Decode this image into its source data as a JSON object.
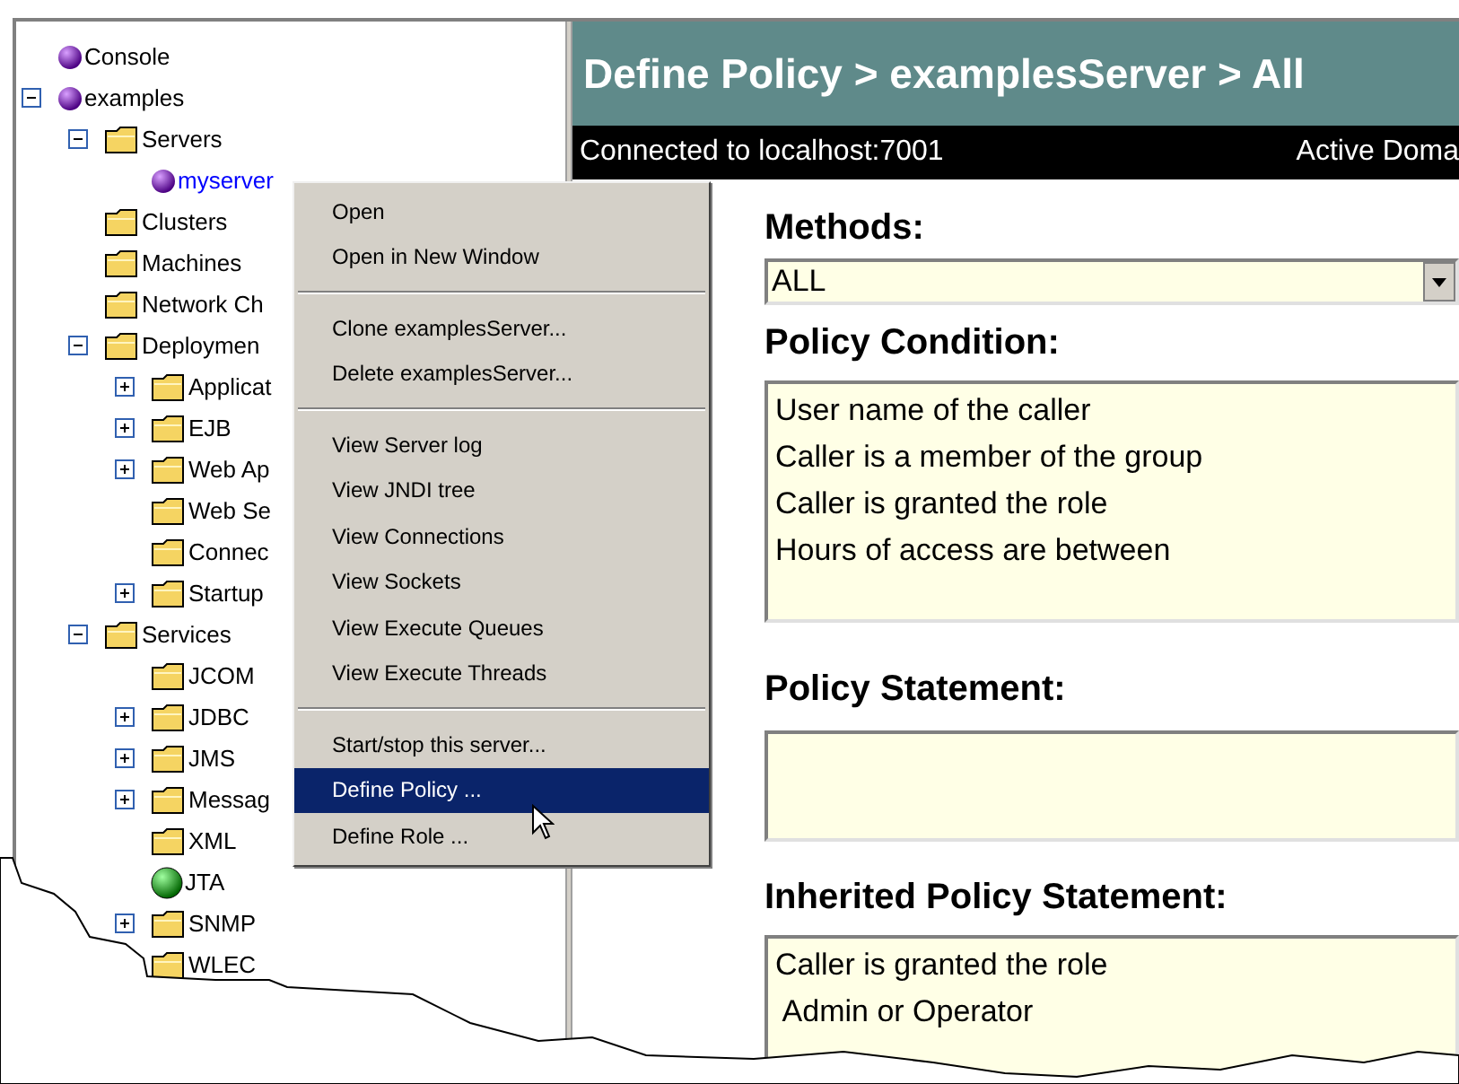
{
  "tree": [
    {
      "label": "Console",
      "kind": "server",
      "selected": false
    },
    {
      "label": "examples",
      "kind": "server",
      "selected": false,
      "expanded": true,
      "children": [
        {
          "label": "Servers",
          "kind": "folder",
          "selected": false,
          "expanded": true,
          "children": [
            {
              "label": "myserver",
              "kind": "server",
              "selected": true
            }
          ]
        },
        {
          "label": "Clusters",
          "kind": "folder",
          "selected": false
        },
        {
          "label": "Machines",
          "kind": "folder",
          "selected": false
        },
        {
          "label": "Network Ch",
          "kind": "folder",
          "selected": false
        },
        {
          "label": "Deploymen",
          "kind": "folder",
          "selected": false,
          "expanded": true,
          "children": [
            {
              "label": "Applicat",
              "kind": "folder",
              "selected": false,
              "expanded": false
            },
            {
              "label": "EJB",
              "kind": "folder",
              "selected": false,
              "expanded": false
            },
            {
              "label": "Web Ap",
              "kind": "folder",
              "selected": false,
              "expanded": false
            },
            {
              "label": "Web Se",
              "kind": "folder",
              "selected": false
            },
            {
              "label": "Connec",
              "kind": "folder",
              "selected": false
            },
            {
              "label": "Startup",
              "kind": "folder",
              "selected": false,
              "expanded": false
            }
          ]
        },
        {
          "label": "Services",
          "kind": "folder",
          "selected": false,
          "expanded": true,
          "children": [
            {
              "label": "JCOM",
              "kind": "folder",
              "selected": false
            },
            {
              "label": "JDBC",
              "kind": "folder",
              "selected": false,
              "expanded": false
            },
            {
              "label": "JMS",
              "kind": "folder",
              "selected": false,
              "expanded": false
            },
            {
              "label": "Messag",
              "kind": "folder",
              "selected": false,
              "expanded": false
            },
            {
              "label": "XML",
              "kind": "folder",
              "selected": false
            },
            {
              "label": "JTA",
              "kind": "running",
              "selected": false
            },
            {
              "label": "SNMP",
              "kind": "folder",
              "selected": false,
              "expanded": false
            },
            {
              "label": "WLEC",
              "kind": "folder",
              "selected": false
            }
          ]
        }
      ]
    }
  ],
  "context_menu": [
    {
      "kind": "item",
      "label": "Open",
      "selected": false
    },
    {
      "kind": "item",
      "label": "Open in New Window",
      "selected": false
    },
    {
      "kind": "separator"
    },
    {
      "kind": "item",
      "label": "Clone examplesServer...",
      "selected": false
    },
    {
      "kind": "item",
      "label": "Delete examplesServer...",
      "selected": false
    },
    {
      "kind": "separator"
    },
    {
      "kind": "item",
      "label": "View Server log",
      "selected": false
    },
    {
      "kind": "item",
      "label": "View JNDI tree",
      "selected": false
    },
    {
      "kind": "item",
      "label": "View Connections",
      "selected": false
    },
    {
      "kind": "item",
      "label": "View Sockets",
      "selected": false
    },
    {
      "kind": "item",
      "label": "View Execute Queues",
      "selected": false
    },
    {
      "kind": "item",
      "label": "View Execute Threads",
      "selected": false
    },
    {
      "kind": "separator"
    },
    {
      "kind": "item",
      "label": "Start/stop this server...",
      "selected": false
    },
    {
      "kind": "item",
      "label": "Define Policy ...",
      "selected": true
    },
    {
      "kind": "item",
      "label": "Define Role ...",
      "selected": false
    }
  ],
  "page": {
    "title": "Define Policy > examplesServer > All",
    "connection": "Connected to localhost:7001",
    "domain": "Active Doma",
    "methods_label": "Methods:",
    "methods_value": "ALL",
    "condition_label": "Policy Condition:",
    "conditions": [
      "User name of the caller",
      "Caller is a member of the group",
      "Caller is granted the role",
      "Hours of access are between"
    ],
    "statement_label": "Policy Statement:",
    "inherited_label": "Inherited Policy Statement:",
    "inherited_lines": [
      "Caller is granted the role",
      " Admin or Operator"
    ]
  }
}
